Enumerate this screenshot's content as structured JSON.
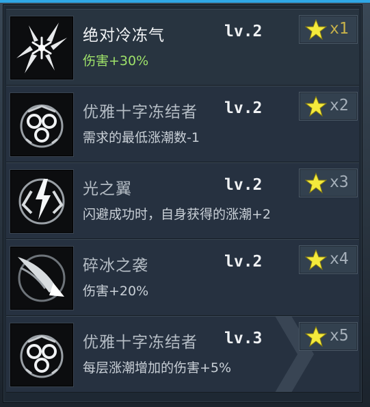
{
  "skills": [
    {
      "name": "绝对冷冻气",
      "level": "lv.2",
      "desc": "伤害+30%",
      "stars": "x1",
      "icon": "snowflake-shard-icon"
    },
    {
      "name": "优雅十字冻结者",
      "level": "lv.2",
      "desc": "需求的最低涨潮数-1",
      "stars": "x2",
      "icon": "cross-freezer-icon"
    },
    {
      "name": "光之翼",
      "level": "lv.2",
      "desc": "闪避成功时，自身获得的涨潮+2",
      "stars": "x3",
      "icon": "lightning-wings-icon"
    },
    {
      "name": "碎冰之袭",
      "level": "lv.2",
      "desc": "伤害+20%",
      "stars": "x4",
      "icon": "ice-comet-icon"
    },
    {
      "name": "优雅十字冻结者",
      "level": "lv.3",
      "desc": "每层涨潮增加的伤害+5%",
      "stars": "x5",
      "icon": "cross-freezer-icon"
    }
  ],
  "colors": {
    "accent": "#2fa7e6",
    "highlight_text": "#9fe36a",
    "star": "#f4ea3c"
  }
}
